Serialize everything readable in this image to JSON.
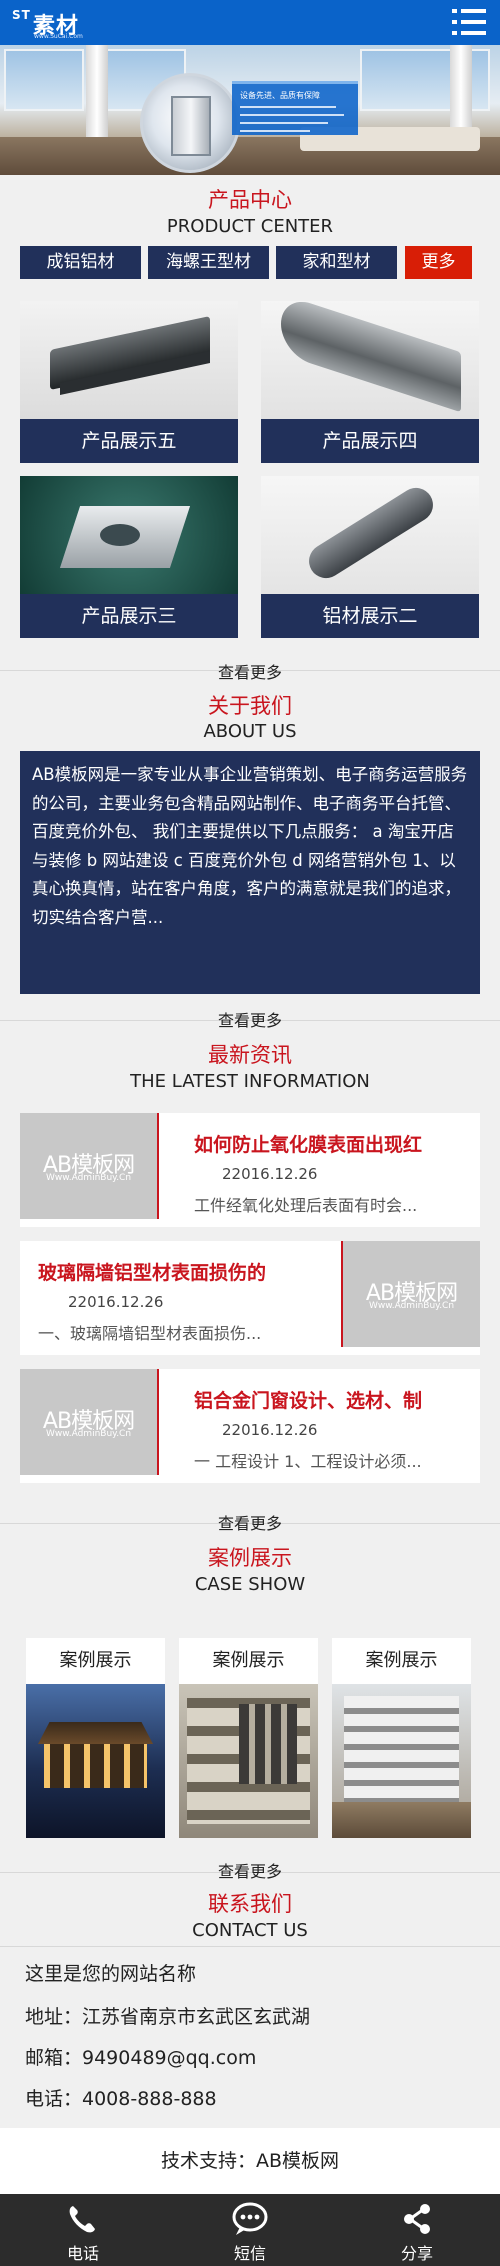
{
  "header": {
    "logo_text": "素材",
    "logo_prefix": "ST",
    "logo_sub": "www.SuCai.Com",
    "menu_icon": "hamburger-menu-icon",
    "brand_color": "#0a63c9"
  },
  "banner": {
    "panel_title": "设备先进、品质有保障"
  },
  "product_center": {
    "title_cn": "产品中心",
    "title_en": "PRODUCT CENTER",
    "tabs": [
      {
        "label": "成铝铝材"
      },
      {
        "label": "海螺王型材"
      },
      {
        "label": "家和型材"
      },
      {
        "label": "更多"
      }
    ],
    "products": [
      {
        "caption": "产品展示五"
      },
      {
        "caption": "产品展示四"
      },
      {
        "caption": "产品展示三"
      },
      {
        "caption": "铝材展示二"
      }
    ],
    "more_label": "查看更多"
  },
  "about": {
    "title_cn": "关于我们",
    "title_en": "ABOUT US",
    "body": "AB模板网是一家专业从事企业营销策划、电子商务运营服务的公司，主要业务包含精品网站制作、电子商务平台托管、百度竞价外包、 我们主要提供以下几点服务： a 淘宝开店与装修 b 网站建设 c 百度竞价外包 d 网络营销外包 1、以真心换真情，站在客户角度，客户的满意就是我们的追求，切实结合客户营...",
    "more_label": "查看更多"
  },
  "news": {
    "title_cn": "最新资讯",
    "title_en": "THE LATEST INFORMATION",
    "thumb_text": "AB模板网",
    "thumb_sub": "Www.AdminBuy.Cn",
    "items": [
      {
        "title": "如何防止氧化膜表面出现红",
        "date": "22016.12.26",
        "desc": "工件经氧化处理后表面有时会..."
      },
      {
        "title": "玻璃隔墙铝型材表面损伤的",
        "date": "22016.12.26",
        "desc": "一、玻璃隔墙铝型材表面损伤..."
      },
      {
        "title": "铝合金门窗设计、选材、制",
        "date": "22016.12.26",
        "desc": "一 工程设计 1、工程设计必须..."
      }
    ],
    "more_label": "查看更多"
  },
  "cases": {
    "title_cn": "案例展示",
    "title_en": "CASE SHOW",
    "items": [
      {
        "label": "案例展示"
      },
      {
        "label": "案例展示"
      },
      {
        "label": "案例展示"
      }
    ],
    "more_label": "查看更多"
  },
  "contact": {
    "title_cn": "联系我们",
    "title_en": "CONTACT US",
    "site_name": "这里是您的网站名称",
    "address": "地址：江苏省南京市玄武区玄武湖",
    "email": "邮箱：9490489@qq.com",
    "phone": "电话：4008-888-888"
  },
  "support": {
    "text": "技术支持：AB模板网"
  },
  "footer": {
    "items": [
      {
        "label": "电话",
        "icon": "phone-icon"
      },
      {
        "label": "短信",
        "icon": "message-icon"
      },
      {
        "label": "分享",
        "icon": "share-icon"
      }
    ]
  },
  "colors": {
    "accent_red": "#c9151e",
    "navy": "#21305a",
    "more_tab": "#d81e06",
    "footer_bg": "#2c2c2c"
  }
}
